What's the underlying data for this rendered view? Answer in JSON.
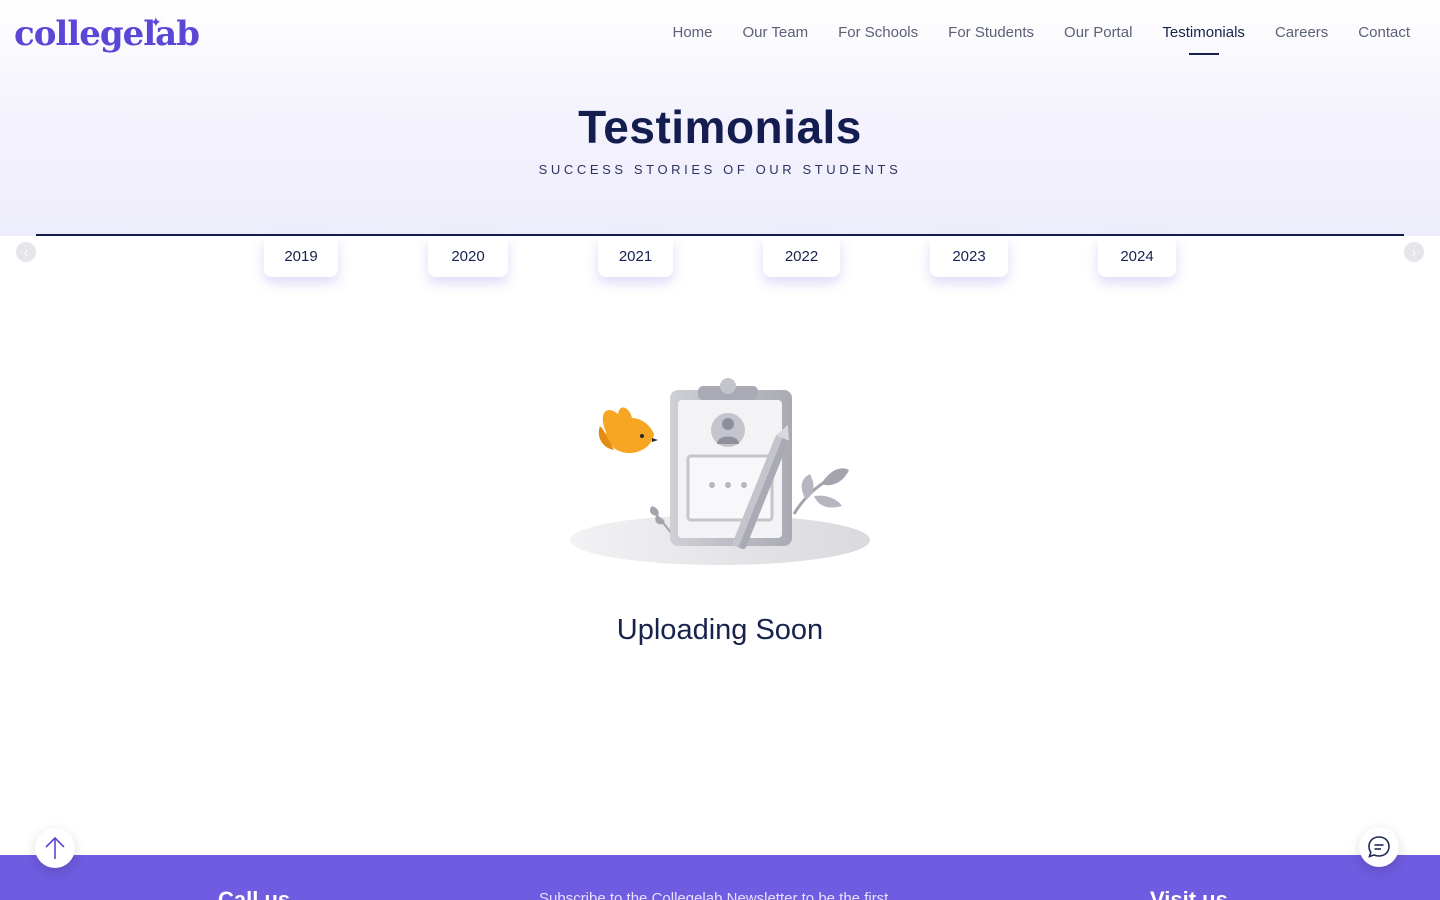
{
  "brand": {
    "logo_text": "collegelab",
    "accent_color": "#5a47d6",
    "footer_color": "#6f5ce0"
  },
  "nav": {
    "items": [
      {
        "label": "Home"
      },
      {
        "label": "Our Team"
      },
      {
        "label": "For Schools"
      },
      {
        "label": "For Students"
      },
      {
        "label": "Our Portal"
      },
      {
        "label": "Testimonials",
        "active": true
      },
      {
        "label": "Careers"
      },
      {
        "label": "Contact"
      }
    ]
  },
  "hero": {
    "title": "Testimonials",
    "subtitle": "SUCCESS STORIES OF OUR STUDENTS"
  },
  "years": [
    "2019",
    "2020",
    "2021",
    "2022",
    "2023",
    "2024"
  ],
  "carousel": {
    "prev_icon": "chevron-left-icon",
    "next_icon": "chevron-right-icon"
  },
  "empty_state": {
    "illustration": "clipboard-with-bird-illustration",
    "message": "Uploading Soon"
  },
  "footer": {
    "call_heading": "Call us",
    "newsletter_text": "Subscribe to the Collegelab Newsletter to be the first",
    "visit_heading": "Visit us"
  },
  "floating": {
    "scroll_top_icon": "arrow-up-icon",
    "chat_icon": "chat-icon"
  }
}
